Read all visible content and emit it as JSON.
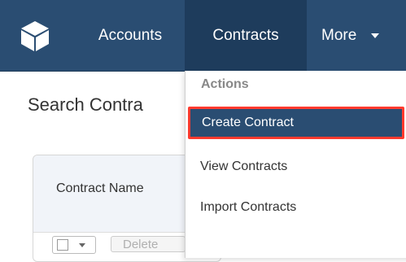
{
  "nav": {
    "items": [
      {
        "label": "Accounts"
      },
      {
        "label": "Contracts"
      },
      {
        "label": "More"
      }
    ],
    "active_color": "#1e3c5c",
    "bar_color": "#2a4d72"
  },
  "page": {
    "title": "Search Contra"
  },
  "list": {
    "column_header": "Contract Name",
    "delete_label": "Delete"
  },
  "dropdown": {
    "section_label": "Actions",
    "items": [
      {
        "label": "Create Contract",
        "highlighted": true,
        "highlight_color": "#ff3b2f"
      },
      {
        "label": "View Contracts"
      },
      {
        "label": "Import Contracts"
      }
    ]
  },
  "icons": {
    "logo": "cube-logo-icon",
    "more_caret": "caret-down-icon"
  }
}
